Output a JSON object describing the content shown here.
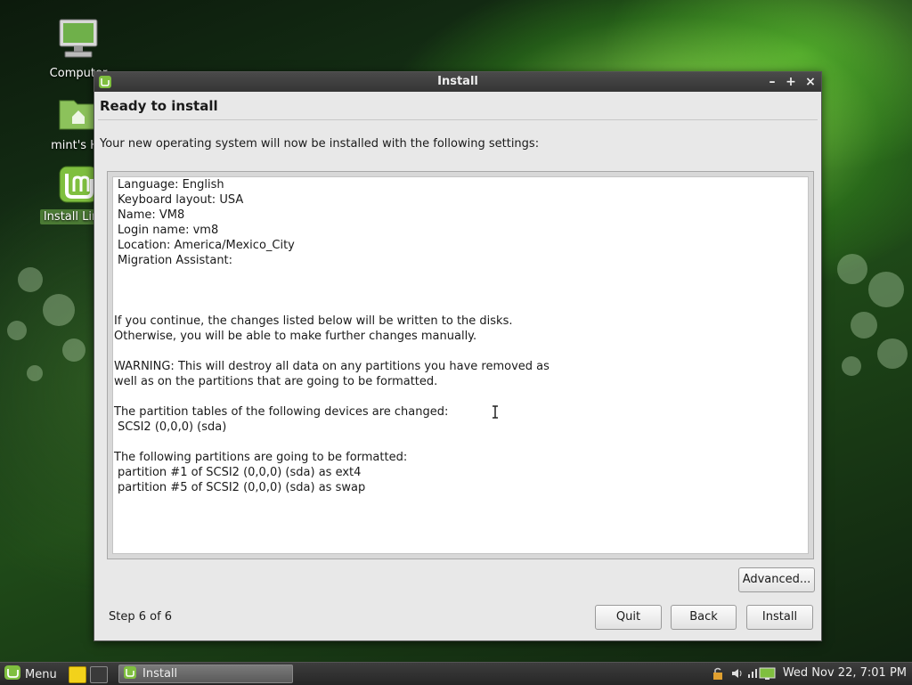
{
  "desktop": {
    "icons": [
      {
        "label": "Computer"
      },
      {
        "label": "mint's Ho"
      },
      {
        "label": "Install Linux"
      }
    ]
  },
  "window": {
    "title": "Install",
    "controls": {
      "minimize": "–",
      "maximize": "+",
      "close": "×"
    },
    "heading": "Ready to install",
    "intro": "Your new operating system will now be installed with the following settings:",
    "summary_lines": [
      "Language: English",
      "Keyboard layout: USA",
      "Name: VM8",
      "Login name: vm8",
      "Location: America/Mexico_City",
      "Migration Assistant:",
      "If you continue, the changes listed below will be written to the disks.",
      "Otherwise, you will be able to make further changes manually.",
      "WARNING: This will destroy all data on any partitions you have removed as",
      "well as on the partitions that are going to be formatted.",
      "The partition tables of the following devices are changed:",
      "SCSI2 (0,0,0) (sda)",
      "The following partitions are going to be formatted:",
      "partition #1 of SCSI2 (0,0,0) (sda) as ext4",
      "partition #5 of SCSI2 (0,0,0) (sda) as swap"
    ],
    "advanced_button": "Advanced...",
    "step_label": "Step 6 of 6",
    "buttons": {
      "quit": "Quit",
      "back": "Back",
      "install": "Install"
    }
  },
  "taskbar": {
    "menu_label": "Menu",
    "task_label": "Install",
    "clock": "Wed Nov 22,  7:01 PM"
  },
  "colors": {
    "accent_green": "#7fbf3f",
    "titlebar": "#3c3c3c"
  }
}
